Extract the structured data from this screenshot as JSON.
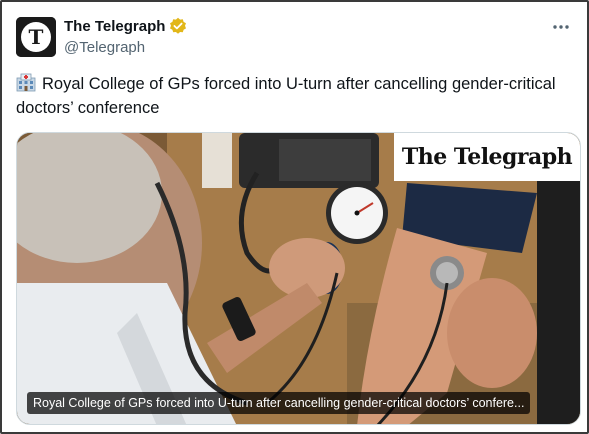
{
  "author": {
    "name": "The Telegraph",
    "handle": "@Telegraph",
    "verified": true,
    "avatar_letter": "T",
    "badge_color": "#e2b719"
  },
  "tweet": {
    "emoji": "hospital-icon",
    "text": "Royal College of GPs forced into U-turn after cancelling gender-critical doctors’ conference"
  },
  "media": {
    "brand_label": "The Telegraph",
    "caption": "Royal College of GPs forced into U-turn after cancelling gender-critical doctors’ confere..."
  },
  "icons": {
    "more": "more-options-icon"
  }
}
